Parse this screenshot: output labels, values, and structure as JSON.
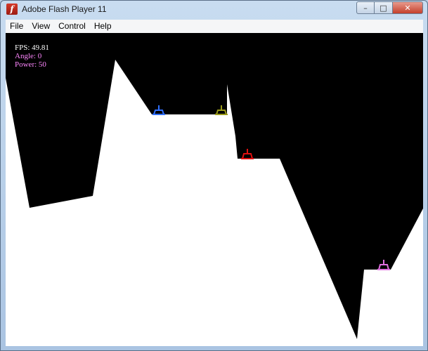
{
  "window": {
    "title": "Adobe Flash Player 11",
    "icon": "flash-icon",
    "controls": {
      "minimize": "–",
      "maximize": "□",
      "close": "✕"
    }
  },
  "menu": [
    "File",
    "View",
    "Control",
    "Help"
  ],
  "hud": {
    "fps": "FPS: 49.81",
    "angle": "Angle: 0",
    "power": "Power: 50",
    "colors": {
      "fps": "#ffffff",
      "angle": "#ff88ff",
      "power": "#ff88ff"
    }
  },
  "game": {
    "sky_color": "#000000",
    "ground_color": "#ffffff",
    "tanks": [
      {
        "name": "blue",
        "color": "#2f6fff"
      },
      {
        "name": "olive",
        "color": "#9a9a1a"
      },
      {
        "name": "red",
        "color": "#e01010"
      },
      {
        "name": "pink",
        "color": "#e070e0"
      }
    ]
  }
}
